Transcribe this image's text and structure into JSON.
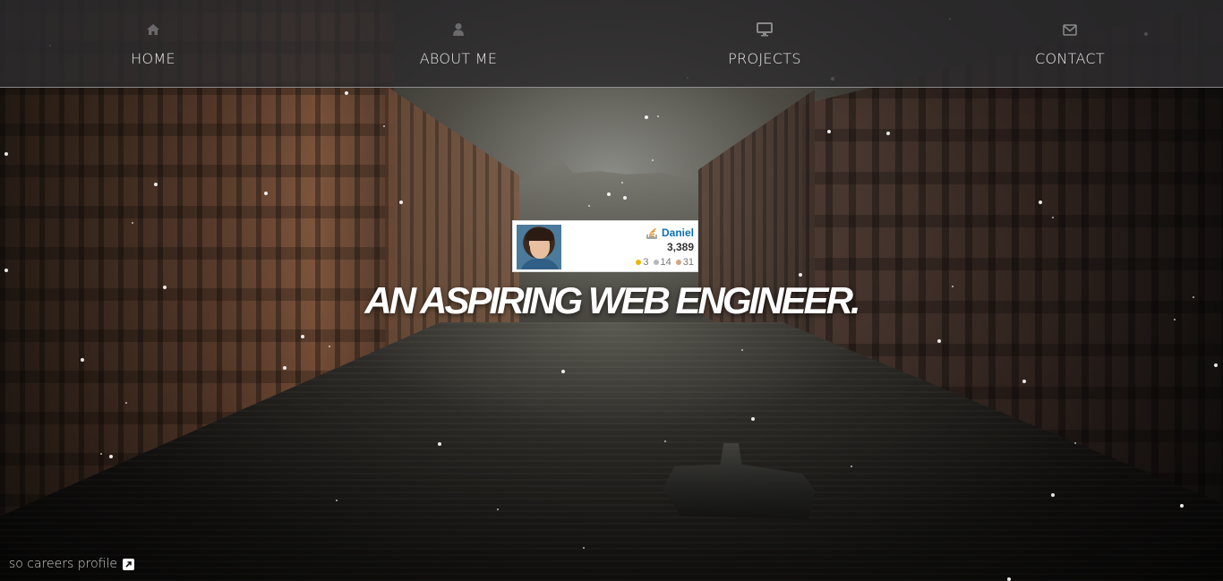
{
  "nav": {
    "items": [
      {
        "label": "HOME",
        "icon": "home-icon"
      },
      {
        "label": "ABOUT ME",
        "icon": "user-icon"
      },
      {
        "label": "PROJECTS",
        "icon": "desktop-icon"
      },
      {
        "label": "CONTACT",
        "icon": "envelope-icon"
      }
    ]
  },
  "flair": {
    "name": "Daniel",
    "reputation": "3,389",
    "badges": {
      "gold": "3",
      "silver": "14",
      "bronze": "31"
    },
    "colors": {
      "name": "#0c70b8",
      "gold": "#f1b600",
      "silver": "#b4b8bc",
      "bronze": "#d1a684"
    }
  },
  "hero": {
    "headline": "AN ASPIRING WEB ENGINEER."
  },
  "footer": {
    "link_label": "so careers profile",
    "link_icon": "external-link-icon"
  }
}
